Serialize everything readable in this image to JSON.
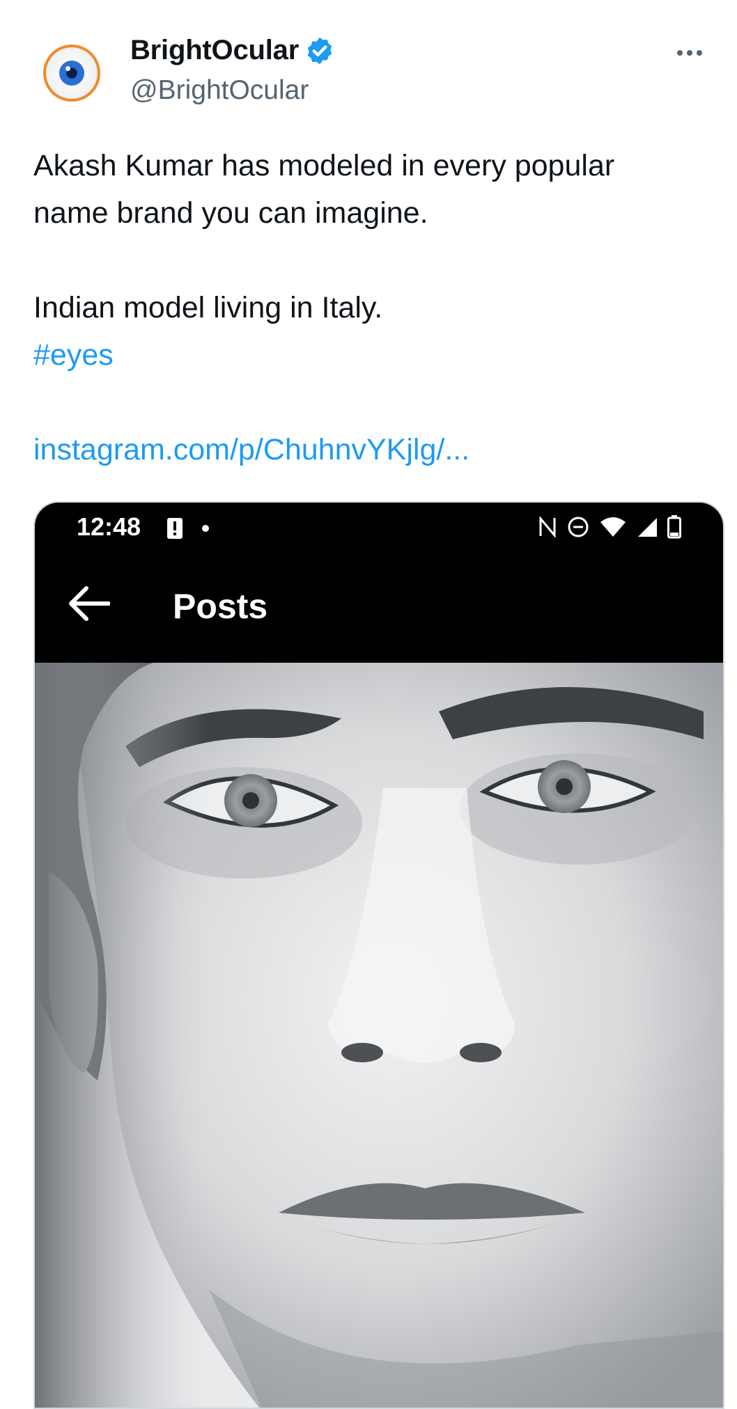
{
  "author": {
    "display_name": "BrightOcular",
    "handle": "@BrightOcular",
    "verified": true
  },
  "tweet": {
    "text_line_1": "Akash Kumar has modeled in every popular",
    "text_line_2": "name brand you can imagine.",
    "text_line_3": "Indian model living in Italy.",
    "hashtag": "#eyes",
    "link": "instagram.com/p/ChuhnvYKjlg/..."
  },
  "embedded_screenshot": {
    "time": "12:48",
    "title": "Posts"
  },
  "icons": [
    "eye-avatar",
    "verified-badge-icon",
    "more-options-icon",
    "alert-icon",
    "nfc-icon",
    "do-not-disturb-icon",
    "wifi-icon",
    "signal-icon",
    "battery-icon",
    "back-arrow-icon"
  ],
  "colors": {
    "link": "#1d9bf0",
    "text": "#0f1419",
    "secondary": "#536471",
    "verified": "#1d9bf0",
    "avatar_ring": "#f08a2a"
  }
}
